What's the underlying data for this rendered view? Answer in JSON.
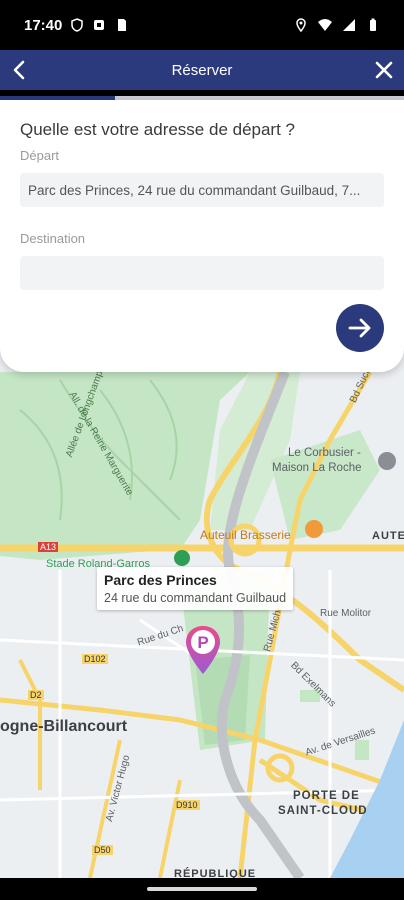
{
  "status_bar": {
    "time": "17:40"
  },
  "header": {
    "title": "Réserver"
  },
  "progress": {
    "fraction": 0.285
  },
  "form": {
    "question": "Quelle est votre adresse de départ ?",
    "departure_label": "Départ",
    "departure_value": "Parc des Princes, 24 rue du commandant Guilbaud, 7...",
    "destination_label": "Destination",
    "destination_value": ""
  },
  "map": {
    "labels": {
      "stade": "Stade Roland-Garros",
      "auteuil_brasserie": "Auteuil Brasserie",
      "le_corbusier_1": "Le Corbusier -",
      "le_corbusier_2": "Maison La Roche",
      "boulogne": "ogne-Billancourt",
      "porte_1": "PORTE DE",
      "porte_2": "SAINT-CLOUD",
      "republique": "RÉPUBLIQUE",
      "aute": "AUTE",
      "a13": "A13",
      "d102": "D102",
      "d2": "D2",
      "d910": "D910",
      "d50": "D50",
      "bd_suchet": "Bd Suchet",
      "bd_exelmans": "Bd Exelmans",
      "rue_molitor": "Rue Molitor",
      "av_versailles": "Av. de Versailles",
      "rue_michel": "Rue Michel",
      "av_victor_hugo": "Av. Victor Hugo",
      "rue_du_ch": "Rue du Ch",
      "allee_reine": "All. de la Reine Marguerite",
      "allee_longchamp": "Allée de Longchamp"
    },
    "place_card": {
      "name": "Parc des Princes",
      "address": "24 rue du commandant Guilbaud"
    },
    "pin_letter": "P"
  },
  "colors": {
    "primary": "#2a3a7c",
    "park_green": "#c5e6c5",
    "road_yellow": "#f7d46a",
    "water_blue": "#a8d0f0",
    "pin_gradient_top": "#e94b8a",
    "pin_gradient_bottom": "#9b5bd6"
  }
}
